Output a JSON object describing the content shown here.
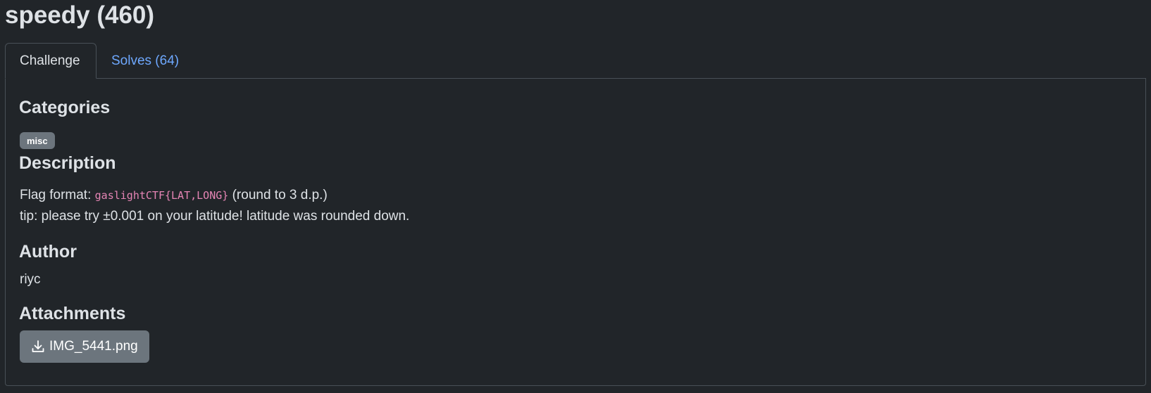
{
  "challenge": {
    "title": "speedy (460)"
  },
  "tabs": [
    {
      "label": "Challenge",
      "active": true
    },
    {
      "label": "Solves (64)",
      "active": false
    }
  ],
  "categories": {
    "heading": "Categories",
    "tags": [
      "misc"
    ]
  },
  "description": {
    "heading": "Description",
    "line1_prefix": "Flag format: ",
    "line1_code": "gaslightCTF{LAT,LONG}",
    "line1_suffix": " (round to 3 d.p.)",
    "line2": "tip: please try ±0.001 on your latitude! latitude was rounded down."
  },
  "author": {
    "heading": "Author",
    "name": "riyc"
  },
  "attachments": {
    "heading": "Attachments",
    "files": [
      {
        "name": "IMG_5441.png",
        "icon": "download-icon"
      }
    ]
  },
  "colors": {
    "background": "#212529",
    "link": "#6ea8fe",
    "badge": "#6c757d",
    "code": "#e685b5"
  }
}
